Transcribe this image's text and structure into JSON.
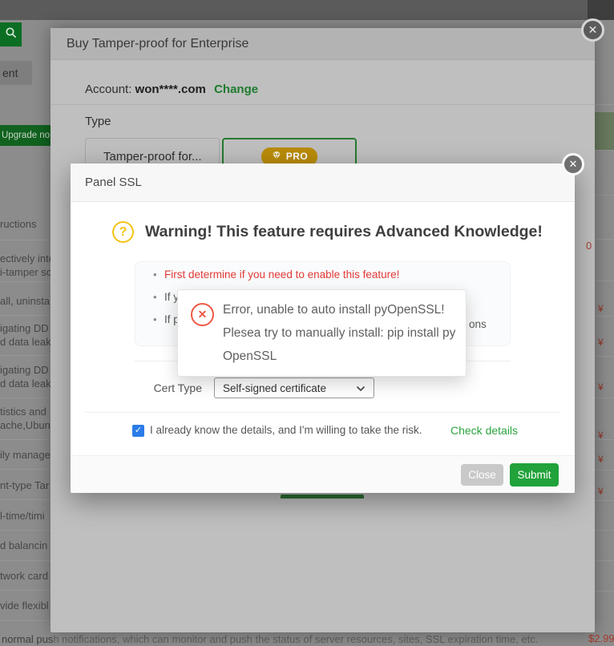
{
  "chrome": {
    "tab_label": "ent",
    "search_icon": "search-icon"
  },
  "background": {
    "upgrade_button_label": "Upgrade no",
    "left_fragments": [
      "ructions",
      "ectively inte",
      "i-tamper sc",
      "all, uninsta",
      "igating DD",
      "d data leaka",
      "igating DD",
      "d data leaka",
      "tistics and",
      "ache,Ubunt",
      "ily manage",
      "nt-type Tar",
      "l-time/timi",
      "d balancin",
      "twork card",
      "vide flexibl"
    ],
    "price_fragments": [
      "¥",
      "¥",
      "¥",
      "¥",
      "¥",
      "¥"
    ],
    "bottom_line_left": "normal pus",
    "bottom_line_rest": "h notifications, which can monitor and push the status of server resources, sites, SSL expiration time, etc.",
    "bottom_price": "$2.99"
  },
  "buy_modal": {
    "title": "Buy Tamper-proof for Enterprise",
    "close_glyph": "✕",
    "account_label": "Account:",
    "account_value": "won****.com",
    "change_link": "Change",
    "type_label": "Type",
    "type_option": "Tamper-proof for...",
    "pro_badge": "PRO",
    "price_fragment": "0"
  },
  "ssl_modal": {
    "title": "Panel SSL",
    "close_glyph": "✕",
    "warning_glyph": "?",
    "warning_title": "Warning! This feature requires Advanced Knowledge!",
    "bullet_first": "First determine if you need to enable this feature!",
    "bullet_second_visible": "If y",
    "bullet_third_visible": "If p",
    "bullet_third_tail": "ons",
    "cert_type_label": "Cert Type",
    "cert_type_value": "Self-signed certificate",
    "checkbox_glyph": "✓",
    "checkbox_label": "I already know the details, and I'm willing to take the risk.",
    "check_details_link": "Check details",
    "close_button": "Close",
    "submit_button": "Submit"
  },
  "error_popup": {
    "icon_glyph": "✕",
    "message": "Error, unable to auto install pyOpenSSL! Plesea try to manually install: pip install py OpenSSL"
  },
  "colors": {
    "accent_green": "#20a53a",
    "pro_gold": "#ba8c09",
    "error_red": "#f05945",
    "warning_yellow": "#f3c318",
    "checkbox_blue": "#2b7ce8"
  }
}
